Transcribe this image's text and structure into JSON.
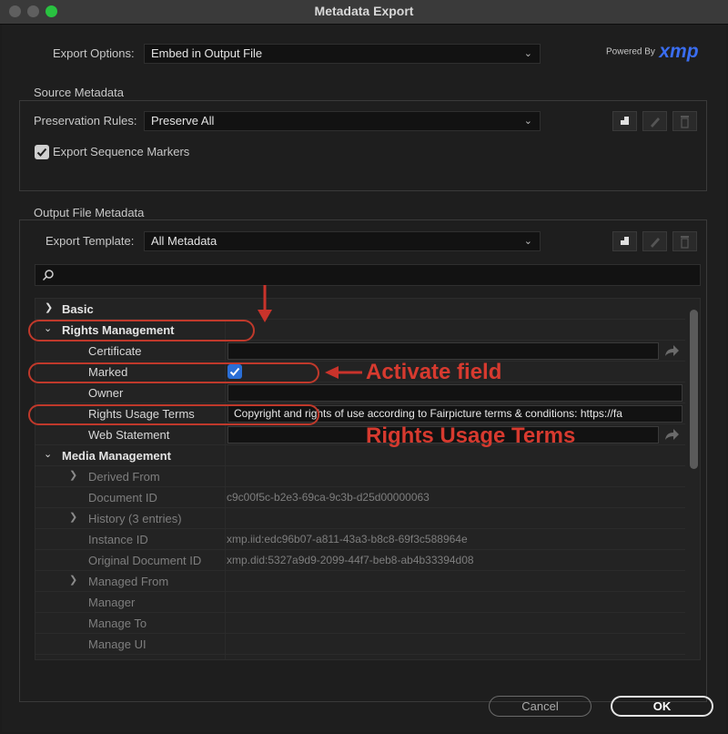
{
  "window": {
    "title": "Metadata Export"
  },
  "export_options": {
    "label": "Export Options:",
    "value": "Embed in Output File"
  },
  "brand": {
    "powered_by": "Powered By",
    "logo": "xmp",
    "color": "#3a6df0"
  },
  "source_metadata": {
    "title": "Source Metadata",
    "preservation_label": "Preservation Rules:",
    "preservation_value": "Preserve All",
    "markers_label": "Export Sequence Markers",
    "markers_checked": true
  },
  "output_metadata": {
    "title": "Output File Metadata",
    "template_label": "Export Template:",
    "template_value": "All Metadata"
  },
  "search": {
    "placeholder": ""
  },
  "tree": {
    "basic": "Basic",
    "rights_management": "Rights Management",
    "certificate": "Certificate",
    "marked": "Marked",
    "marked_checked": true,
    "owner": "Owner",
    "rights_usage_terms": "Rights Usage Terms",
    "rights_usage_terms_value": "Copyright and rights of use according to Fairpicture terms & conditions: https://fa",
    "web_statement": "Web Statement",
    "media_management": "Media Management",
    "derived_from": "Derived From",
    "document_id": "Document ID",
    "document_id_value": "c9c00f5c-b2e3-69ca-9c3b-d25d00000063",
    "history": "History (3 entries)",
    "instance_id": "Instance ID",
    "instance_id_value": "xmp.iid:edc96b07-a811-43a3-b8c8-69f3c588964e",
    "original_document_id": "Original Document ID",
    "original_document_id_value": "xmp.did:5327a9d9-2099-44f7-beb8-ab4b33394d08",
    "managed_from": "Managed From",
    "manager": "Manager",
    "manage_to": "Manage To",
    "manage_ui": "Manage UI"
  },
  "buttons": {
    "cancel": "Cancel",
    "ok": "OK"
  },
  "annotations": {
    "activate_field": "Activate field",
    "rights_usage_terms": "Rights Usage Terms",
    "color": "#d73a2f"
  }
}
